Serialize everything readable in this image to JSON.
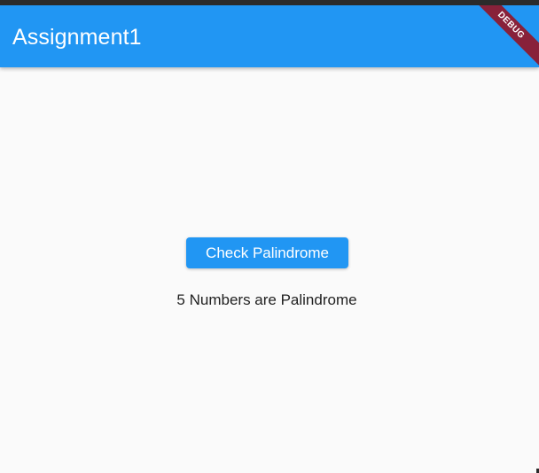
{
  "appbar": {
    "title": "Assignment1",
    "debug_banner": "DEBUG",
    "color": "#2196f3"
  },
  "main": {
    "check_button_label": "Check Palindrome",
    "result_text": "5 Numbers are Palindrome"
  },
  "colors": {
    "accent": "#2196f3",
    "background": "#fafafa",
    "debug_banner": "#88213a"
  }
}
